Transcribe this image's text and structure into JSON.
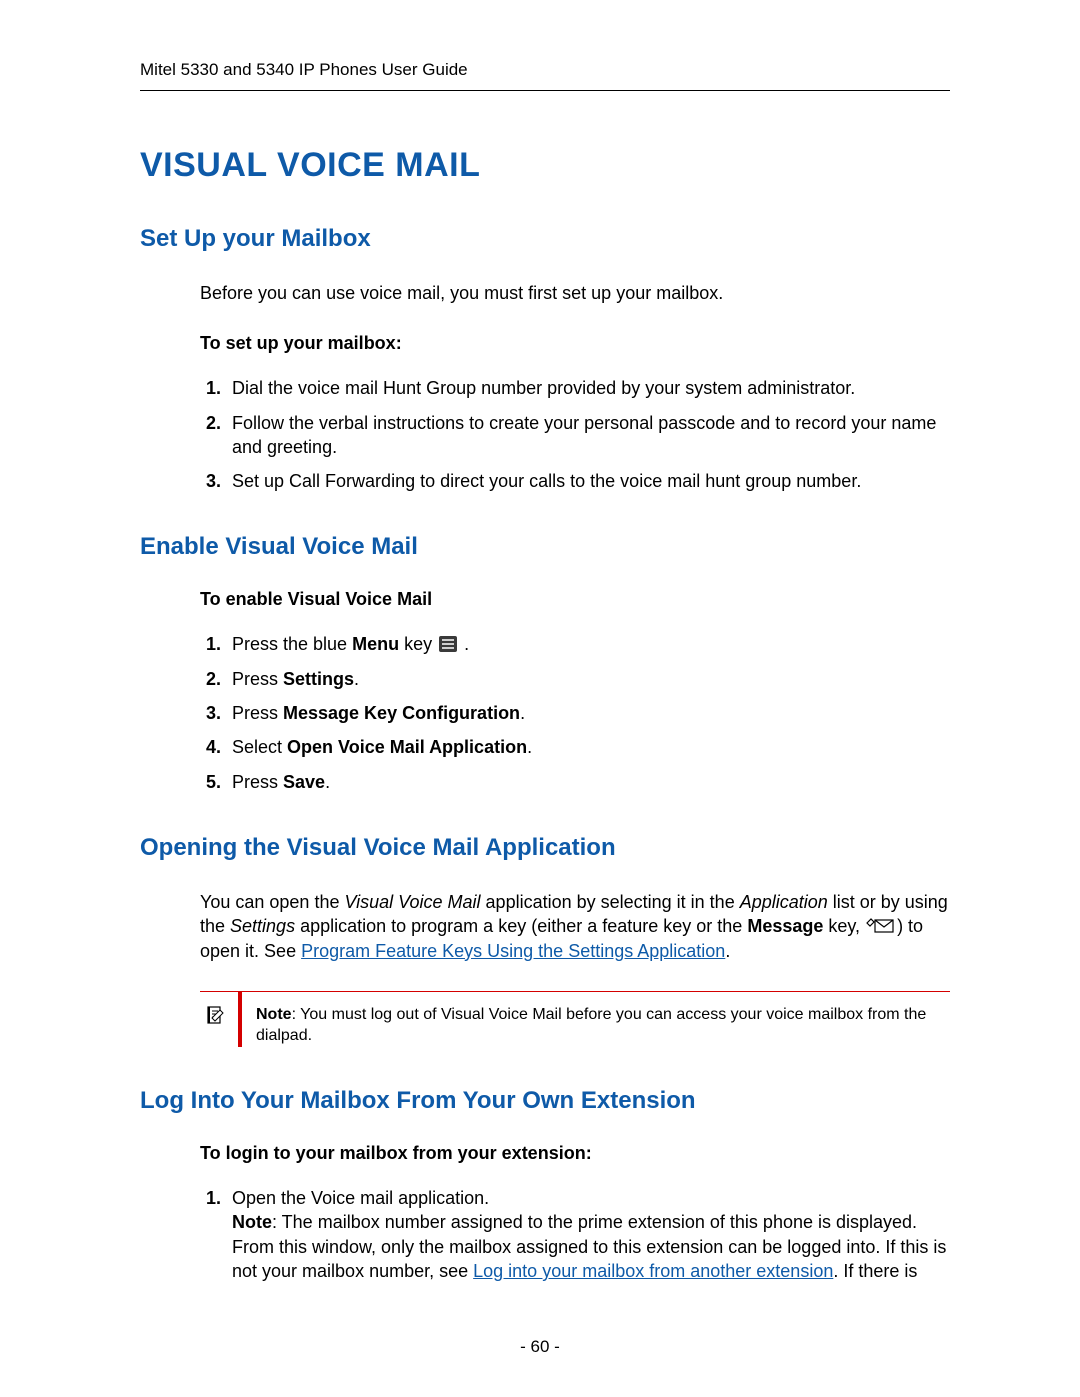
{
  "header": {
    "running": "Mitel 5330 and 5340 IP Phones User Guide"
  },
  "title": "VISUAL VOICE MAIL",
  "sections": {
    "setup": {
      "heading": "Set Up your Mailbox",
      "intro": "Before you can use voice mail, you must first set up your mailbox.",
      "lead": "To set up your mailbox:",
      "steps": [
        "Dial the voice mail Hunt Group number provided by your system administrator.",
        "Follow the verbal instructions to create your personal passcode and to record your name and greeting.",
        "Set up Call Forwarding to direct your calls to the voice mail hunt group number."
      ]
    },
    "enable": {
      "heading": "Enable Visual Voice Mail",
      "lead": "To enable Visual Voice Mail",
      "steps": {
        "s1_pre": "Press the blue ",
        "s1_bold": "Menu",
        "s1_post": " key ",
        "s1_end": " .",
        "s2_pre": "Press ",
        "s2_bold": "Settings",
        "s2_end": ".",
        "s3_pre": "Press ",
        "s3_bold": "Message Key Configuration",
        "s3_end": ".",
        "s4_pre": "Select ",
        "s4_bold": "Open Voice Mail Application",
        "s4_end": ".",
        "s5_pre": "Press ",
        "s5_bold": "Save",
        "s5_end": "."
      }
    },
    "opening": {
      "heading": "Opening the Visual Voice Mail Application",
      "p1_a": "You can open the ",
      "p1_em1": "Visual Voice Mail",
      "p1_b": " application by selecting it in the ",
      "p1_em2": "Application",
      "p1_c": " list or by using the ",
      "p1_em3": "Settings",
      "p1_d": " application to program a key (either a feature key or the ",
      "p1_bold": "Message",
      "p1_e": " key, ",
      "p1_f": ") to open it. See ",
      "p1_link": "Program Feature Keys Using the Settings Application",
      "p1_g": ".",
      "note_label": "Note",
      "note_text": ": You must log out of Visual Voice Mail before you can access your voice mailbox from the dialpad."
    },
    "login": {
      "heading": "Log Into Your Mailbox From Your Own Extension",
      "lead": "To login to your mailbox from your extension:",
      "s1": "Open the Voice mail application.",
      "s1_note_label": "Note",
      "s1_note_a": ": The mailbox number assigned to the prime extension of this phone is displayed. From this window, only the mailbox assigned to this extension can be logged into. If this is not your mailbox number, see ",
      "s1_link": "Log into your mailbox from another extension",
      "s1_note_b": ". If there is"
    }
  },
  "footer": {
    "page_number": "- 60 -"
  }
}
